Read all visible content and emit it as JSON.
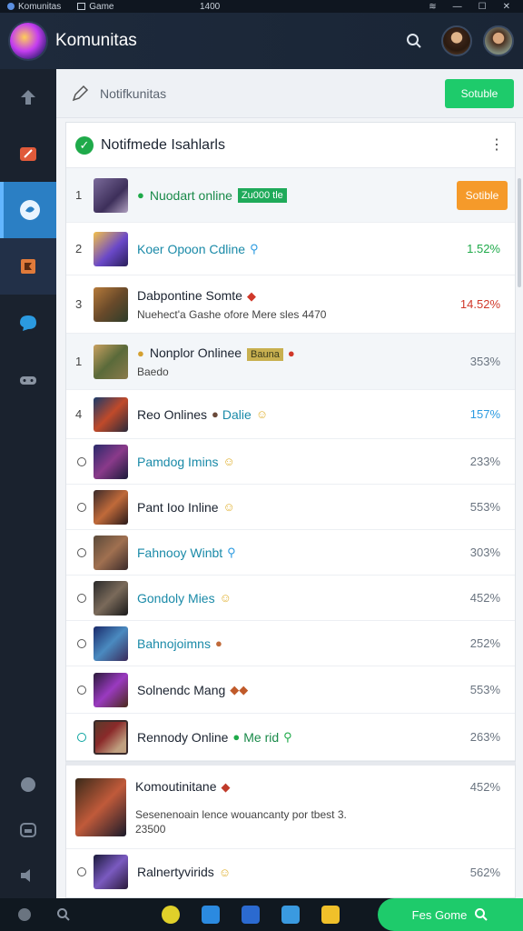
{
  "titlebar": {
    "app": "Komunitas",
    "section": "Game",
    "time": "1400"
  },
  "header": {
    "title": "Komunitas"
  },
  "crumb": {
    "text": "Notifkunitas",
    "button": "Sotuble"
  },
  "card": {
    "title": "Notifmede Isahlarls",
    "rows": [
      {
        "rank": "1",
        "name": "Nuodart online",
        "tag": "Zu000 tle",
        "badge": "Sotible"
      },
      {
        "rank": "2",
        "name": "Koer Opoon Cdline",
        "pct": "1.52%"
      },
      {
        "rank": "3",
        "name": "Dabpontine Somte",
        "sub": "Nuehect'a Gashe ofore Mere sles 4470",
        "pct": "14.52%"
      },
      {
        "rank": "1",
        "name": "Nonplor Onlinee",
        "tag": "Bauna",
        "sub": "Baedo",
        "pct": "353%"
      },
      {
        "rank": "4",
        "name": "Reo Onlines",
        "extra": "Dalie",
        "pct": "157%"
      },
      {
        "name": "Pamdog Imins",
        "pct": "233%"
      },
      {
        "name": "Pant Ioo Inline",
        "pct": "553%"
      },
      {
        "name": "Fahnooy Winbt",
        "pct": "303%"
      },
      {
        "name": "Gondoly Mies",
        "pct": "452%"
      },
      {
        "name": "Bahnojoimns",
        "pct": "252%"
      },
      {
        "name": "Solnendc Mang",
        "pct": "553%"
      },
      {
        "name": "Rennody Online",
        "extra": "Me rid",
        "pct": "263%"
      }
    ]
  },
  "card2": {
    "rows": [
      {
        "name": "Komoutinitane",
        "sub": "Sesenenoain lence wouancanty por tbest 3.",
        "sub2": "23500",
        "pct": "452%"
      },
      {
        "name": "Ralnerty​virids",
        "pct": "562%"
      }
    ]
  },
  "taskbar": {
    "cta": "Fes Gome"
  }
}
